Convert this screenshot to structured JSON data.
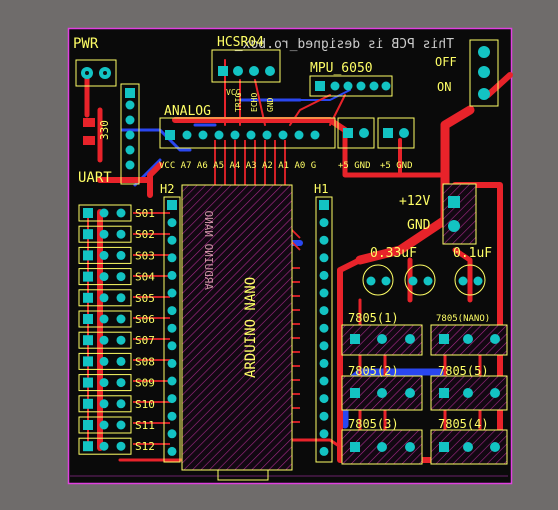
{
  "board": {
    "credit_text": "This PCB is designed_ro.box_",
    "colors": {
      "background": "#6f6c6b",
      "board": "#0a0a0a",
      "outline": "#e040e0",
      "silkscreen": "#ffff66",
      "top_copper": "#e8232a",
      "bottom_copper": "#2a47f0",
      "pad": "#13c3c3",
      "hatch": "#a82a8a"
    }
  },
  "labels": {
    "pwr": "PWR",
    "resistor": "330",
    "uart": "UART",
    "hcsr04": "HCSR04",
    "hc_pins": [
      "VCC",
      "TRIG",
      "ECHO",
      "GND"
    ],
    "mpu": "MPU_6050",
    "analog": "ANALOG",
    "analog_pins": "VCC A7 A6 A5 A4 A3 A2 A1 A0 G",
    "pwr_pins_a": "+5 GND",
    "pwr_pins_b": "+5 GND",
    "off": "OFF",
    "on": "ON",
    "v12": "+12V",
    "gnd": "GND",
    "cap1": "0.33uF",
    "cap2": "0.1uF",
    "h1": "H1",
    "h2": "H2",
    "nano": "ARDUINO NANO",
    "nano_mirror": "ARDUINO NANO",
    "servos": [
      "S01",
      "S02",
      "S03",
      "S04",
      "S05",
      "S06",
      "S07",
      "S08",
      "S09",
      "S10",
      "S11",
      "S12"
    ],
    "regulators": {
      "r1": "7805(1)",
      "r_nano": "7805(NANO)",
      "r2": "7805(2)",
      "r5": "7805(5)",
      "r3": "7805(3)",
      "r4": "7805(4)"
    }
  }
}
